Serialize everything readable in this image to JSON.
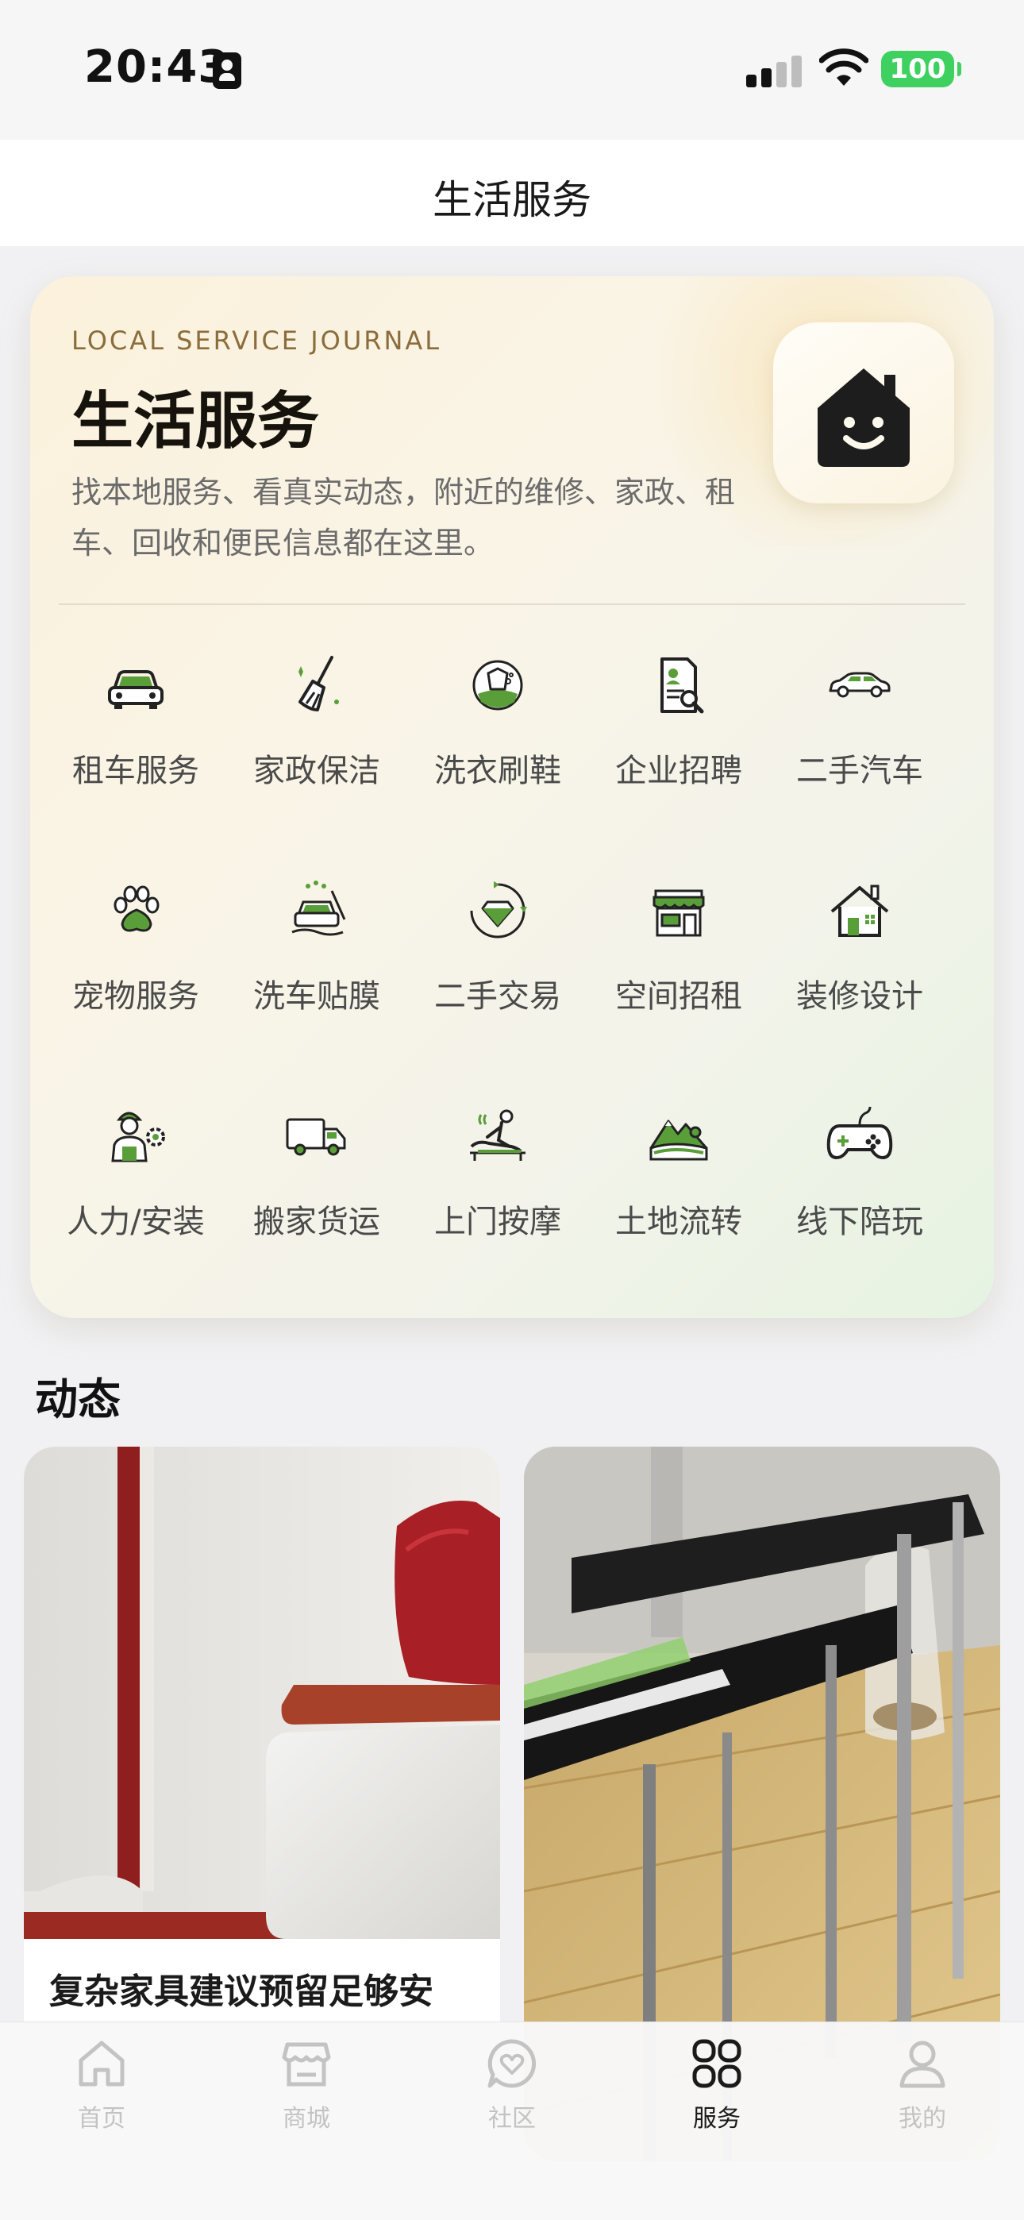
{
  "status_bar": {
    "time": "20:43",
    "battery": "100"
  },
  "nav": {
    "title": "生活服务"
  },
  "hero": {
    "kicker": "LOCAL SERVICE JOURNAL",
    "title": "生活服务",
    "description": "找本地服务、看真实动态，附近的维修、家政、租车、回收和便民信息都在这里。",
    "logo_icon": "smiling-house-icon"
  },
  "services": [
    {
      "label": "租车服务",
      "icon": "car-icon"
    },
    {
      "label": "家政保洁",
      "icon": "broom-icon"
    },
    {
      "label": "洗衣刷鞋",
      "icon": "laundry-icon"
    },
    {
      "label": "企业招聘",
      "icon": "resume-search-icon"
    },
    {
      "label": "二手汽车",
      "icon": "sedan-icon"
    },
    {
      "label": "宠物服务",
      "icon": "paw-icon"
    },
    {
      "label": "洗车贴膜",
      "icon": "car-wash-icon"
    },
    {
      "label": "二手交易",
      "icon": "recycle-diamond-icon"
    },
    {
      "label": "空间招租",
      "icon": "storefront-icon"
    },
    {
      "label": "装修设计",
      "icon": "house-icon"
    },
    {
      "label": "人力/安装",
      "icon": "worker-gear-icon"
    },
    {
      "label": "搬家货运",
      "icon": "truck-icon"
    },
    {
      "label": "上门按摩",
      "icon": "massage-icon"
    },
    {
      "label": "土地流转",
      "icon": "land-mountain-icon"
    },
    {
      "label": "线下陪玩",
      "icon": "gamepad-icon"
    }
  ],
  "feed": {
    "section_title": "动态",
    "cards": [
      {
        "title": "复杂家具建议预留足够安",
        "image": "white-sofa-red-cushion-photo"
      },
      {
        "title": "",
        "image": "black-table-wood-floor-photo"
      }
    ]
  },
  "tab_bar": {
    "tabs": [
      {
        "label": "首页",
        "icon": "home-icon",
        "active": false
      },
      {
        "label": "商城",
        "icon": "shop-icon",
        "active": false
      },
      {
        "label": "社区",
        "icon": "community-heart-icon",
        "active": false
      },
      {
        "label": "服务",
        "icon": "grid-services-icon",
        "active": true
      },
      {
        "label": "我的",
        "icon": "user-icon",
        "active": false
      }
    ]
  },
  "colors": {
    "accent_green": "#5a9e3a",
    "ink": "#1c1c1c",
    "kicker": "#8a6d3b"
  }
}
